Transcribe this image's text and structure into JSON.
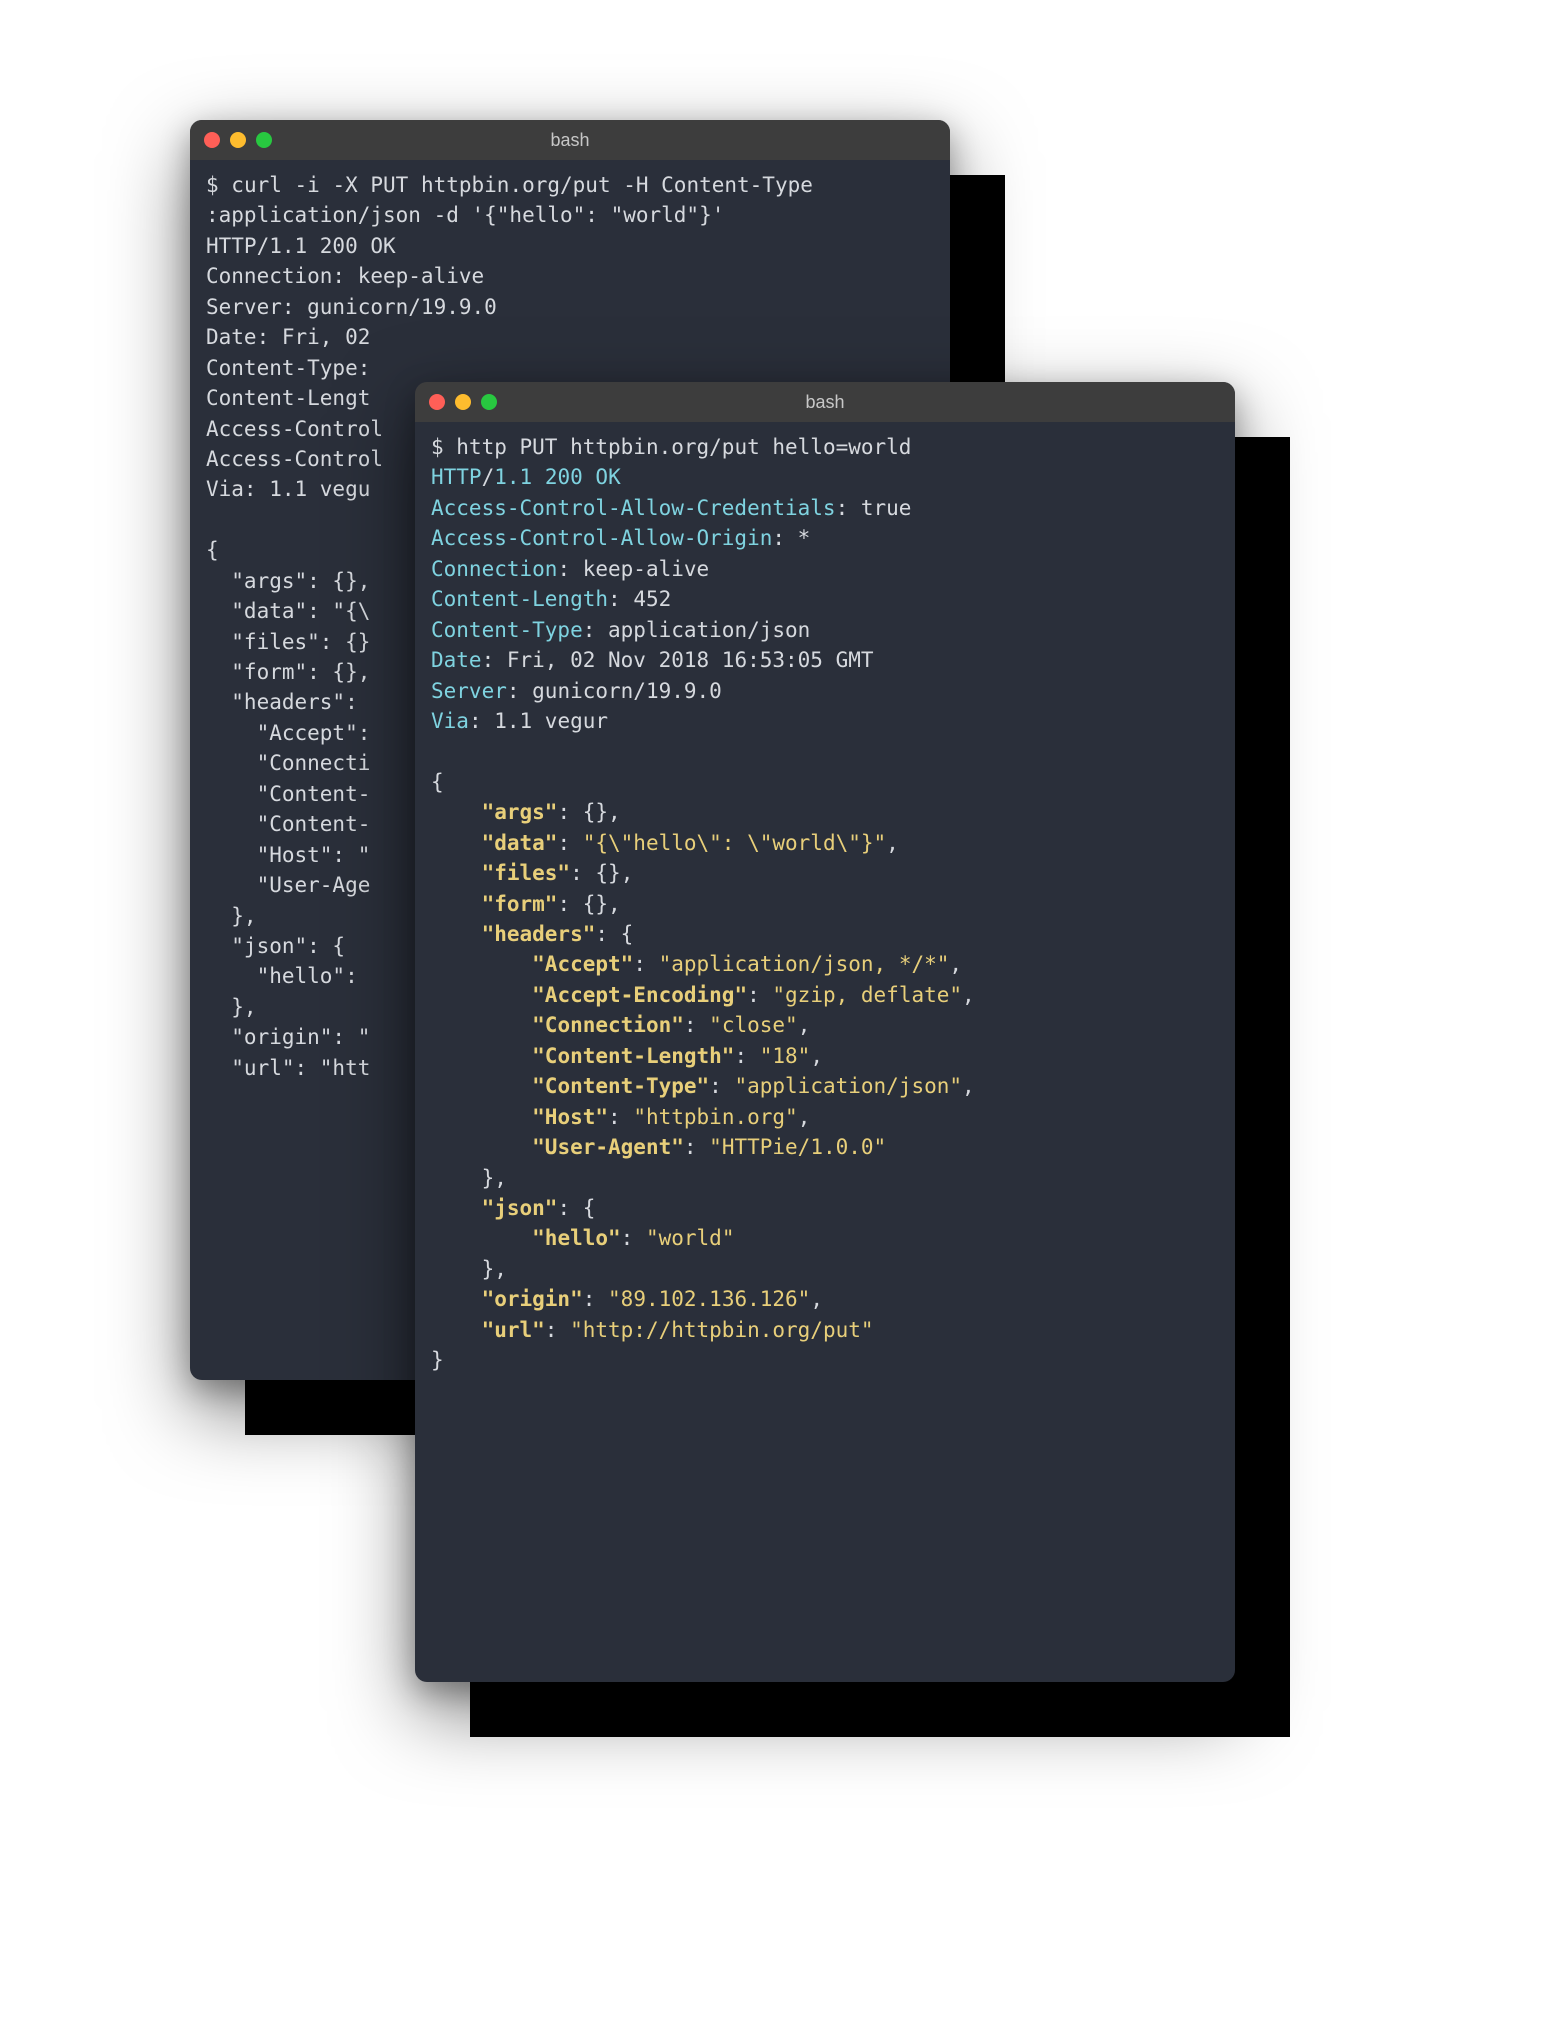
{
  "windows": {
    "back": {
      "title": "bash",
      "prompt": "$ ",
      "command_line1": "curl -i -X PUT httpbin.org/put -H Content-Type",
      "command_line2": ":application/json -d '{\"hello\": \"world\"}'",
      "response": [
        "HTTP/1.1 200 OK",
        "Connection: keep-alive",
        "Server: gunicorn/19.9.0",
        "Date: Fri, 02 ",
        "Content-Type: ",
        "Content-Lengt",
        "Access-Control",
        "Access-Control",
        "Via: 1.1 vegu"
      ],
      "json_lines": [
        "{",
        "  \"args\": {},",
        "  \"data\": \"{\\",
        "  \"files\": {}",
        "  \"form\": {},",
        "  \"headers\": ",
        "    \"Accept\": ",
        "    \"Connecti",
        "    \"Content-",
        "    \"Content-",
        "    \"Host\": \"",
        "    \"User-Age",
        "  },",
        "  \"json\": {",
        "    \"hello\": ",
        "  },",
        "  \"origin\": \"",
        "  \"url\": \"htt"
      ]
    },
    "front": {
      "title": "bash",
      "prompt": "$ ",
      "command": "http PUT httpbin.org/put hello=world",
      "status_line": {
        "proto": "HTTP",
        "slash": "/",
        "ver": "1.1",
        "code": "200",
        "msg": "OK"
      },
      "headers": [
        {
          "k": "Access-Control-Allow-Credentials",
          "v": " true"
        },
        {
          "k": "Access-Control-Allow-Origin",
          "v": " *"
        },
        {
          "k": "Connection",
          "v": " keep-alive"
        },
        {
          "k": "Content-Length",
          "v": " 452"
        },
        {
          "k": "Content-Type",
          "v": " application/json"
        },
        {
          "k": "Date",
          "v": " Fri, 02 Nov 2018 16:53:05 GMT"
        },
        {
          "k": "Server",
          "v": " gunicorn/19.9.0"
        },
        {
          "k": "Via",
          "v": " 1.1 vegur"
        }
      ],
      "json": {
        "open": "{",
        "lines": [
          {
            "indent": 1,
            "key": "args",
            "sep": ": ",
            "val": "{}",
            "comma": ","
          },
          {
            "indent": 1,
            "key": "data",
            "sep": ": ",
            "val": "\"{\\\"hello\\\": \\\"world\\\"}\"",
            "comma": ","
          },
          {
            "indent": 1,
            "key": "files",
            "sep": ": ",
            "val": "{}",
            "comma": ","
          },
          {
            "indent": 1,
            "key": "form",
            "sep": ": ",
            "val": "{}",
            "comma": ","
          },
          {
            "indent": 1,
            "key": "headers",
            "sep": ": ",
            "val": "{",
            "comma": ""
          },
          {
            "indent": 2,
            "key": "Accept",
            "sep": ": ",
            "val": "\"application/json, */*\"",
            "comma": ","
          },
          {
            "indent": 2,
            "key": "Accept-Encoding",
            "sep": ": ",
            "val": "\"gzip, deflate\"",
            "comma": ","
          },
          {
            "indent": 2,
            "key": "Connection",
            "sep": ": ",
            "val": "\"close\"",
            "comma": ","
          },
          {
            "indent": 2,
            "key": "Content-Length",
            "sep": ": ",
            "val": "\"18\"",
            "comma": ","
          },
          {
            "indent": 2,
            "key": "Content-Type",
            "sep": ": ",
            "val": "\"application/json\"",
            "comma": ","
          },
          {
            "indent": 2,
            "key": "Host",
            "sep": ": ",
            "val": "\"httpbin.org\"",
            "comma": ","
          },
          {
            "indent": 2,
            "key": "User-Agent",
            "sep": ": ",
            "val": "\"HTTPie/1.0.0\"",
            "comma": ""
          },
          {
            "indent": 1,
            "closer": "},",
            "plain": true
          },
          {
            "indent": 1,
            "key": "json",
            "sep": ": ",
            "val": "{",
            "comma": ""
          },
          {
            "indent": 2,
            "key": "hello",
            "sep": ": ",
            "val": "\"world\"",
            "comma": ""
          },
          {
            "indent": 1,
            "closer": "},",
            "plain": true
          },
          {
            "indent": 1,
            "key": "origin",
            "sep": ": ",
            "val": "\"89.102.136.126\"",
            "comma": ","
          },
          {
            "indent": 1,
            "key": "url",
            "sep": ": ",
            "val": "\"http://httpbin.org/put\"",
            "comma": ""
          }
        ],
        "close": "}"
      }
    }
  }
}
